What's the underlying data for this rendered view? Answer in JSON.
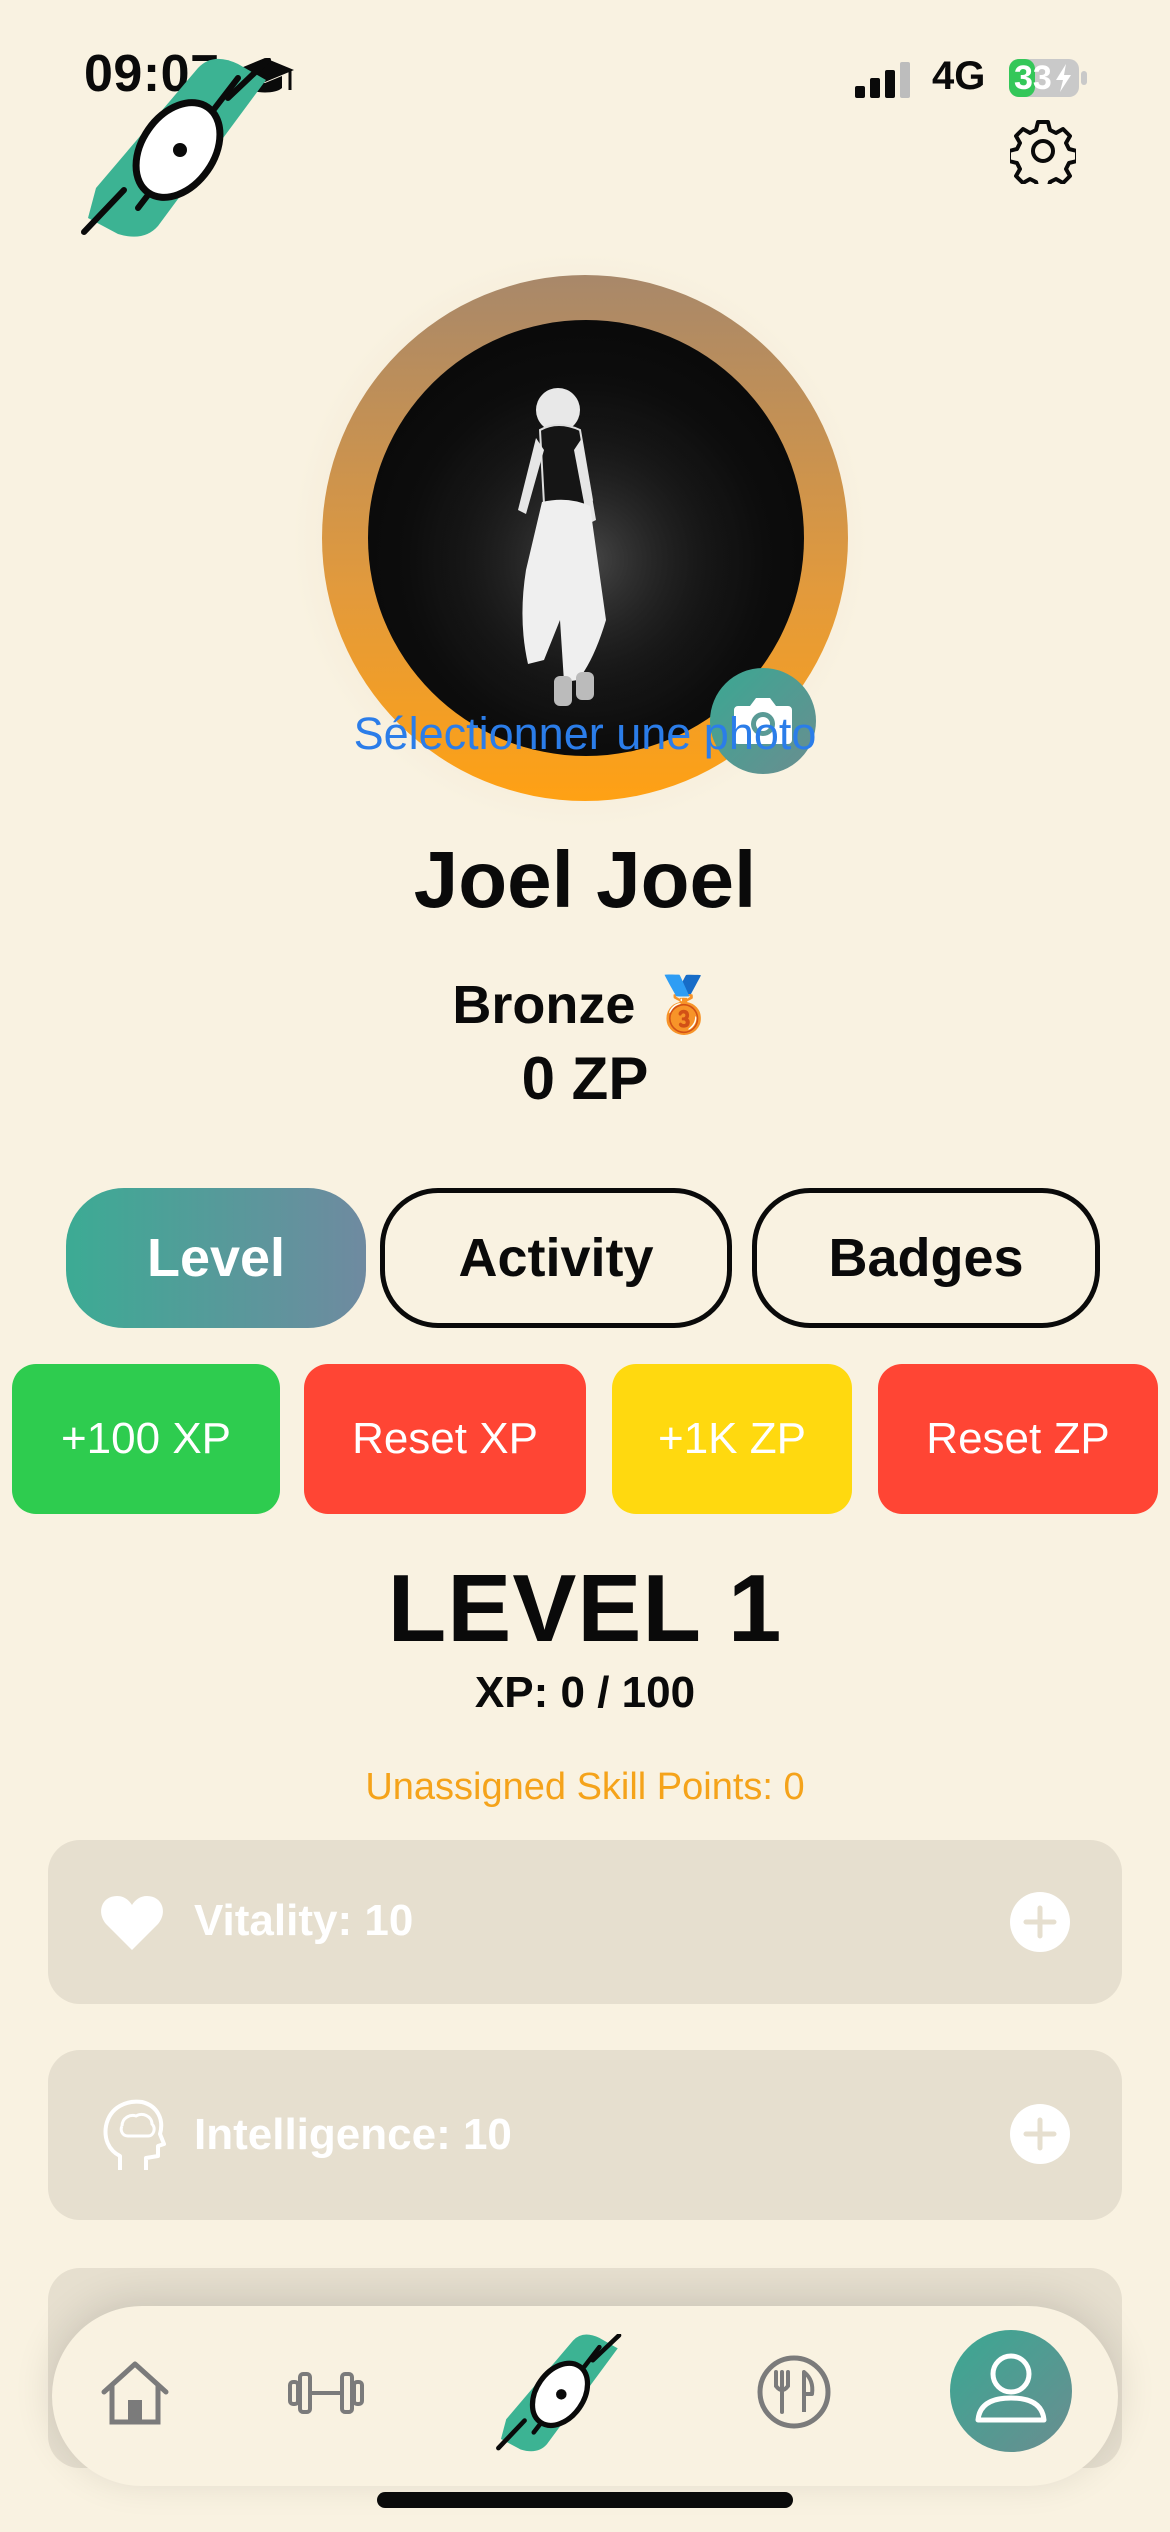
{
  "status_bar": {
    "time": "09:07",
    "network": "4G",
    "battery": "33"
  },
  "profile": {
    "select_photo_label": "Sélectionner une photo",
    "name": "Joel Joel",
    "rank": "Bronze",
    "rank_medal": "🥉",
    "zp": "0 ZP"
  },
  "tabs": [
    {
      "label": "Level",
      "active": true
    },
    {
      "label": "Activity",
      "active": false
    },
    {
      "label": "Badges",
      "active": false
    }
  ],
  "actions": {
    "add_xp": "+100 XP",
    "reset_xp": "Reset XP",
    "add_zp": "+1K ZP",
    "reset_zp": "Reset ZP"
  },
  "level": {
    "title": "LEVEL 1",
    "xp": "XP: 0 / 100",
    "unassigned": "Unassigned Skill Points: 0"
  },
  "stats": [
    {
      "label": "Vitality: 10",
      "icon": "heart-icon"
    },
    {
      "label": "Intelligence: 10",
      "icon": "brain-head-icon"
    }
  ],
  "colors": {
    "background": "#f9f2e1",
    "accent_teal": "#3aa893",
    "green": "#2ecc4f",
    "red": "#ff4534",
    "yellow": "#ffd90f",
    "orange_text": "#f5a31a",
    "link_blue": "#2b7de9"
  },
  "nav": [
    {
      "name": "home-icon"
    },
    {
      "name": "dumbbell-icon"
    },
    {
      "name": "app-logo-icon"
    },
    {
      "name": "restaurant-icon"
    },
    {
      "name": "profile-icon",
      "active": true
    }
  ]
}
